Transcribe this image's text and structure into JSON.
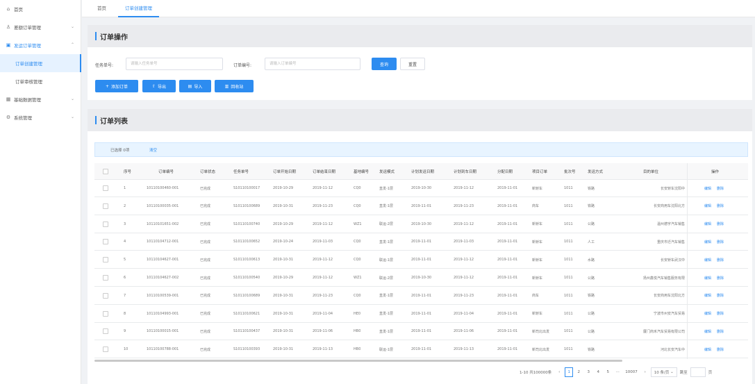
{
  "sidebar": {
    "items": [
      {
        "label": "首页",
        "icon": "home-icon"
      },
      {
        "label": "差额订单管理",
        "icon": "user-icon"
      },
      {
        "label": "发运订单管理",
        "icon": "doc-icon"
      },
      {
        "label": "订单创建管理",
        "icon": ""
      },
      {
        "label": "订单审核管理",
        "icon": ""
      },
      {
        "label": "基础数据管理",
        "icon": "grid-icon"
      },
      {
        "label": "系统管理",
        "icon": "gear-icon"
      }
    ]
  },
  "tabs": [
    {
      "label": "首页"
    },
    {
      "label": "订单创建管理"
    }
  ],
  "ops": {
    "title": "订单操作",
    "plan_label": "任务单号:",
    "plan_placeholder": "请输入任务单号",
    "order_label": "订单编号:",
    "order_placeholder": "请输入订单编号",
    "query": "查询",
    "reset": "重置",
    "add": "添加订单",
    "export": "导出",
    "import": "导入",
    "recycle": "回收站"
  },
  "list": {
    "title": "订单列表",
    "selected": "已选择 0项",
    "clear": "清空",
    "columns": [
      "序号",
      "订单编号",
      "订单状态",
      "任务单号",
      "订单开始日期",
      "订单结束日期",
      "基地编号",
      "发运模式",
      "计划发运日期",
      "计划到车日期",
      "分配日期",
      "项目订单",
      "批次号",
      "发运方式",
      "目的单位",
      "操作"
    ],
    "edit": "编辑",
    "delete": "删除",
    "rows": [
      [
        "1",
        "10110100460-001",
        "已完成",
        "S10110100017",
        "2019-10-29",
        "2019-11-12",
        "CQ0",
        "直发-1层",
        "2019-10-30",
        "2019-11-12",
        "2019-11-01",
        "新轿车",
        "1011",
        "铁路",
        "长安轿车沈阳中"
      ],
      [
        "2",
        "10110100035-001",
        "已完成",
        "S10110100689",
        "2019-10-31",
        "2019-11-23",
        "CQ0",
        "直发-1层",
        "2019-11-01",
        "2019-11-23",
        "2019-11-01",
        "商车",
        "1011",
        "铁路",
        "长安商用车沈阳北方"
      ],
      [
        "3",
        "10110101651-002",
        "已完成",
        "S10110100740",
        "2019-10-29",
        "2019-11-12",
        "WZ1",
        "联运-2层",
        "2019-10-30",
        "2019-11-12",
        "2019-11-01",
        "新轿车",
        "1011",
        "公路",
        "温州德宇汽车销售"
      ],
      [
        "4",
        "10110104712-001",
        "已完成",
        "S10110100652",
        "2019-10-24",
        "2019-11-03",
        "CQ0",
        "直发-1层",
        "2019-11-01",
        "2019-11-03",
        "2019-11-01",
        "新轿车",
        "1011",
        "人工",
        "重庆市迁汽车销售"
      ],
      [
        "5",
        "10110104627-001",
        "已完成",
        "S10110100613",
        "2019-10-31",
        "2019-11-12",
        "CQ0",
        "联运-1层",
        "2019-11-01",
        "2019-11-12",
        "2019-11-01",
        "新轿车",
        "1011",
        "水路",
        "长安轿车武汉中"
      ],
      [
        "6",
        "10110104627-002",
        "已完成",
        "S10110100540",
        "2019-10-29",
        "2019-11-12",
        "WZ1",
        "联运-2层",
        "2019-10-30",
        "2019-11-12",
        "2019-11-01",
        "新轿车",
        "1011",
        "公路",
        "扬州鑫悦汽车销售服务有限"
      ],
      [
        "7",
        "10110100539-001",
        "已完成",
        "S10110100689",
        "2019-10-31",
        "2019-11-23",
        "CQ0",
        "直发-1层",
        "2019-11-01",
        "2019-11-23",
        "2019-11-01",
        "商车",
        "1011",
        "铁路",
        "长安商用车沈阳北方"
      ],
      [
        "8",
        "10110104993-001",
        "已完成",
        "S10110100621",
        "2019-10-31",
        "2019-11-04",
        "HE0",
        "直发-1层",
        "2019-11-01",
        "2019-11-04",
        "2019-11-01",
        "新轿车",
        "1011",
        "公路",
        "宁波市州安汽车贸易"
      ],
      [
        "9",
        "10110100015-001",
        "已完成",
        "S10110100437",
        "2019-10-31",
        "2019-11-06",
        "HB0",
        "直发-1层",
        "2019-11-01",
        "2019-11-06",
        "2019-11-01",
        "新司北出发",
        "1011",
        "公路",
        "厦门商禾汽车贸易有限公司"
      ],
      [
        "10",
        "10110100788-001",
        "已完成",
        "S10110100393",
        "2019-10-31",
        "2019-11-13",
        "HB0",
        "联运-1层",
        "2019-11-01",
        "2019-11-13",
        "2019-11-01",
        "新司北出发",
        "1011",
        "铁路",
        "河北长安汽车中"
      ]
    ]
  },
  "pager": {
    "total": "1-10 共100000条",
    "pages": [
      "1",
      "2",
      "3",
      "4",
      "5"
    ],
    "ellipsis": "···",
    "last": "10007",
    "size": "10 条/页",
    "jump": "跳至",
    "page_unit": "页"
  }
}
